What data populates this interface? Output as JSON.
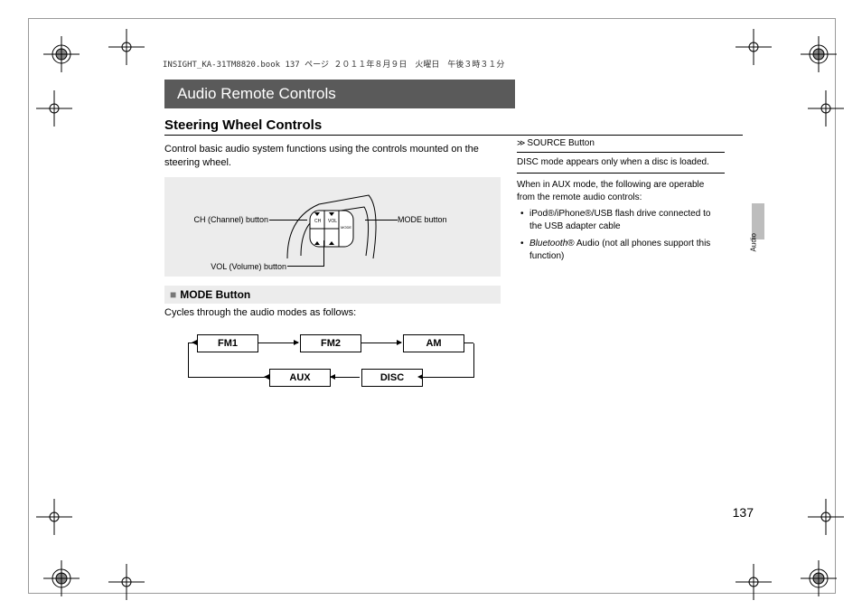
{
  "header_line": "INSIGHT_KA-31TM8820.book  137 ページ  ２０１１年８月９日　火曜日　午後３時３１分",
  "title": "Audio Remote Controls",
  "subtitle": "Steering Wheel Controls",
  "intro": "Control basic audio system functions using the controls mounted on the steering wheel.",
  "diagram": {
    "ch_label": "CH (Channel) button",
    "vol_label": "VOL (Volume) button",
    "mode_label": "MODE button"
  },
  "mode_section": {
    "heading": "MODE Button",
    "desc": "Cycles through the audio modes as follows:"
  },
  "flow": {
    "fm1": "FM1",
    "fm2": "FM2",
    "am": "AM",
    "aux": "AUX",
    "disc": "DISC"
  },
  "side": {
    "heading": "SOURCE Button",
    "note1": "DISC mode appears only when a disc is loaded.",
    "note2": "When in AUX mode, the following are operable from the remote audio controls:",
    "bullet1_a": "iPod®/iPhone®/USB flash drive connected to the USB adapter cable",
    "bullet2_a": "Bluetooth",
    "bullet2_b": "® Audio (not all phones support this function)"
  },
  "side_tab": "Audio",
  "page_number": "137"
}
